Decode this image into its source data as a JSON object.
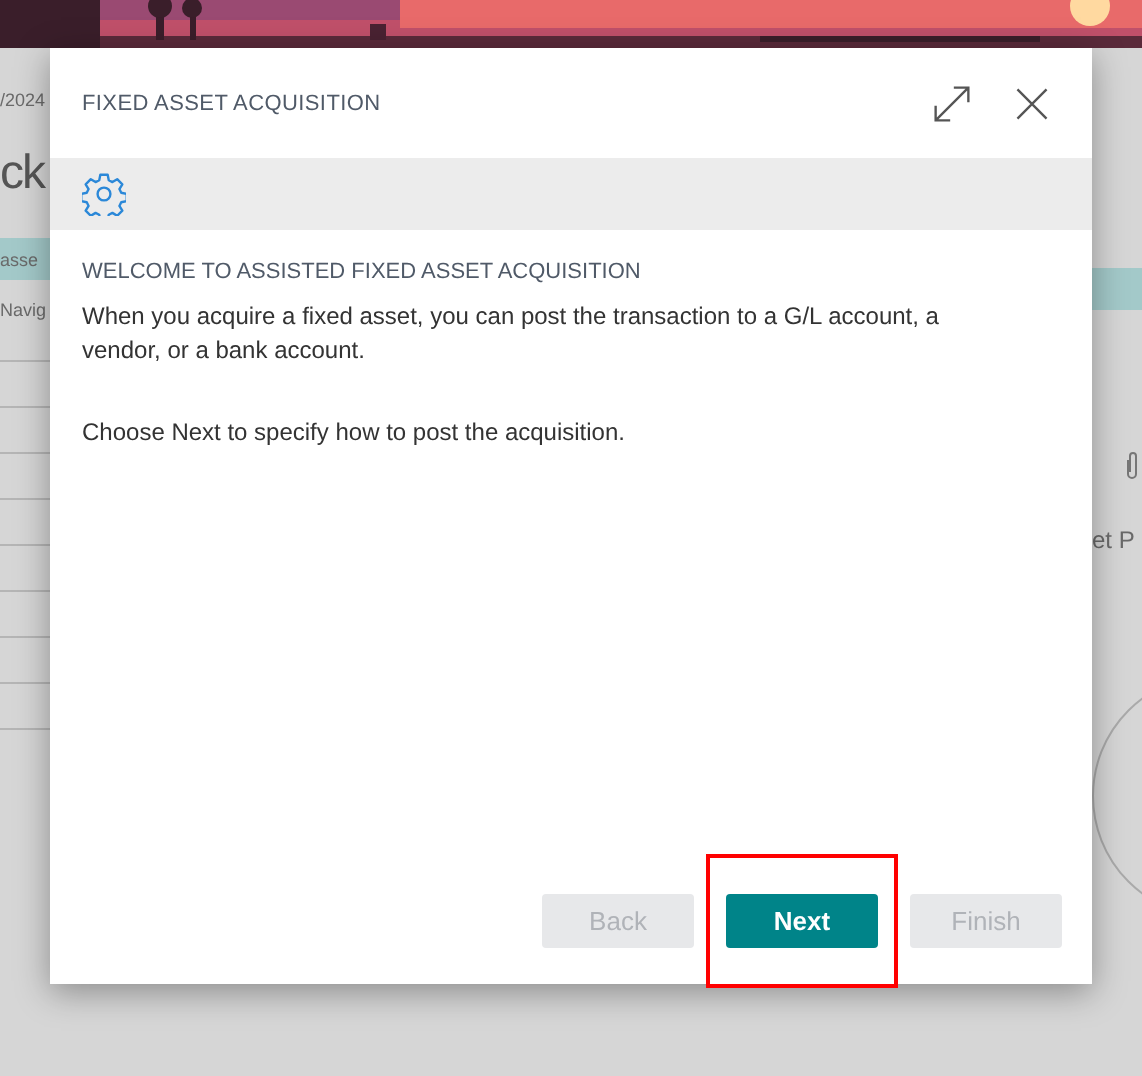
{
  "background_page": {
    "left_texts": [
      "/2024",
      "ck",
      "asse",
      "Navig"
    ],
    "right_texts": [
      "et P"
    ]
  },
  "dialog": {
    "title": "FIXED ASSET ACQUISITION",
    "heading": "WELCOME TO ASSISTED FIXED ASSET ACQUISITION",
    "paragraphs": [
      "When you acquire a fixed asset, you can post the transaction to a G/L account, a vendor, or a bank account.",
      "Choose Next to specify how to post the acquisition."
    ],
    "buttons": [
      {
        "label": "Back",
        "disabled": true,
        "highlighted": false
      },
      {
        "label": "Next",
        "disabled": false,
        "highlighted": true
      },
      {
        "label": "Finish",
        "disabled": true,
        "highlighted": false
      }
    ]
  }
}
